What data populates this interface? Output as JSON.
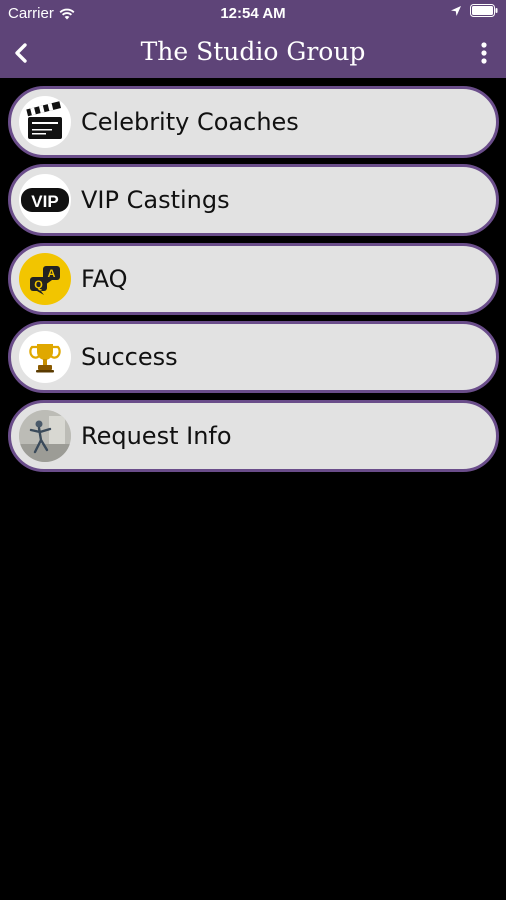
{
  "status_bar": {
    "carrier": "Carrier",
    "time": "12:54 AM",
    "icons": [
      "wifi-icon",
      "location-arrow-icon",
      "battery-icon"
    ]
  },
  "nav": {
    "title": "The Studio Group",
    "back_icon": "chevron-left-icon",
    "more_icon": "vertical-ellipsis-icon"
  },
  "colors": {
    "header": "#5e4478",
    "item_border": "#6a4d8a",
    "item_bg": "#e2e2e2",
    "background": "#000000"
  },
  "menu": {
    "items": [
      {
        "label": "Celebrity Coaches",
        "icon": "clapperboard-icon"
      },
      {
        "label": "VIP Castings",
        "icon": "vip-icon",
        "icon_text": "VIP"
      },
      {
        "label": "FAQ",
        "icon": "qa-bubbles-icon"
      },
      {
        "label": "Success",
        "icon": "trophy-icon"
      },
      {
        "label": "Request Info",
        "icon": "photo-thumbnail-icon"
      }
    ]
  }
}
